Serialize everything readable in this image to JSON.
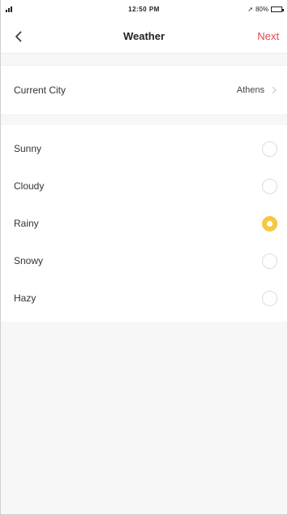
{
  "status_bar": {
    "time": "12:50 PM",
    "battery_text": "80%",
    "battery_level": 0.8
  },
  "nav": {
    "back_icon": "chevron-left-icon",
    "title": "Weather",
    "next_label": "Next"
  },
  "current_city": {
    "label": "Current City",
    "value": "Athens"
  },
  "weather_options": [
    {
      "label": "Sunny",
      "selected": false
    },
    {
      "label": "Cloudy",
      "selected": false
    },
    {
      "label": "Rainy",
      "selected": true
    },
    {
      "label": "Snowy",
      "selected": false
    },
    {
      "label": "Hazy",
      "selected": false
    }
  ],
  "colors": {
    "accent": "#e8434f",
    "selected": "#f5c842",
    "background": "#f7f7f7"
  }
}
